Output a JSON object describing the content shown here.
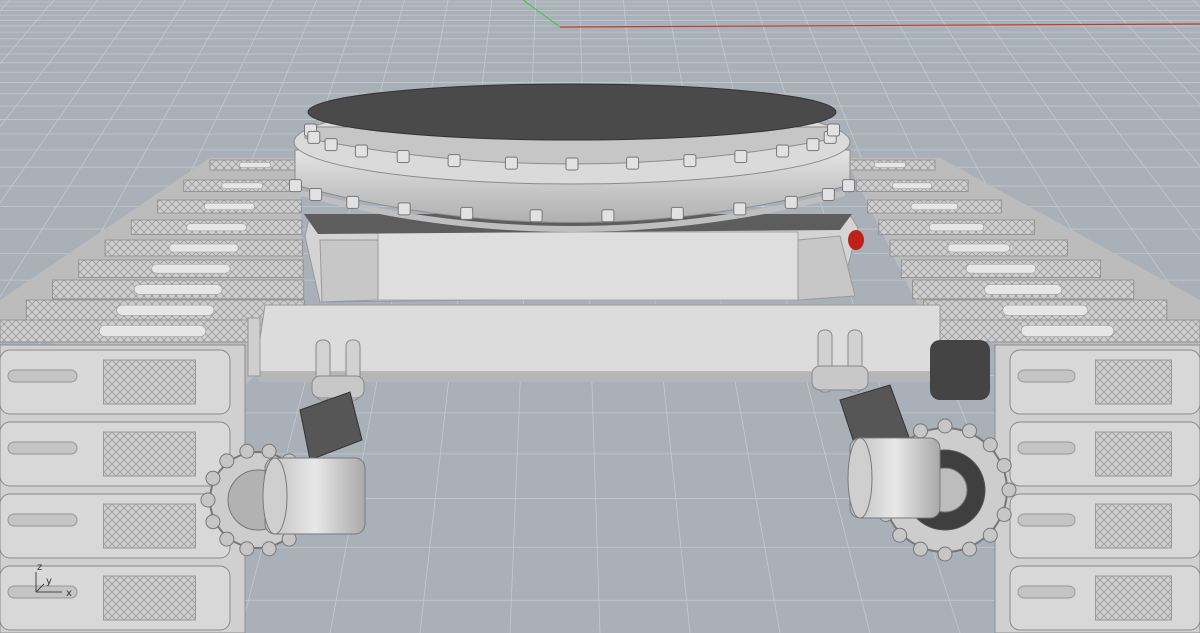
{
  "viewport": {
    "name": "Perspective",
    "background_color": "#a9b0b8",
    "grid_line_color": "#c4c9cf",
    "x_axis_color": "#c0392b",
    "y_axis_color": "#2ecc40"
  },
  "axis_gizmo": {
    "z_label": "z",
    "y_label": "y",
    "x_label": "x"
  },
  "model": {
    "body_color": "#d6d6d6",
    "shadow_color": "#a8a8a8",
    "dark_color": "#3a3a3a",
    "accent_color": "#c0201a",
    "parts": [
      "turntable-top",
      "turntable-flange",
      "turntable-base",
      "chassis-frame",
      "left-track",
      "right-track",
      "left-drive-sprocket",
      "right-drive-sprocket",
      "left-drive-motor",
      "right-drive-motor"
    ]
  }
}
